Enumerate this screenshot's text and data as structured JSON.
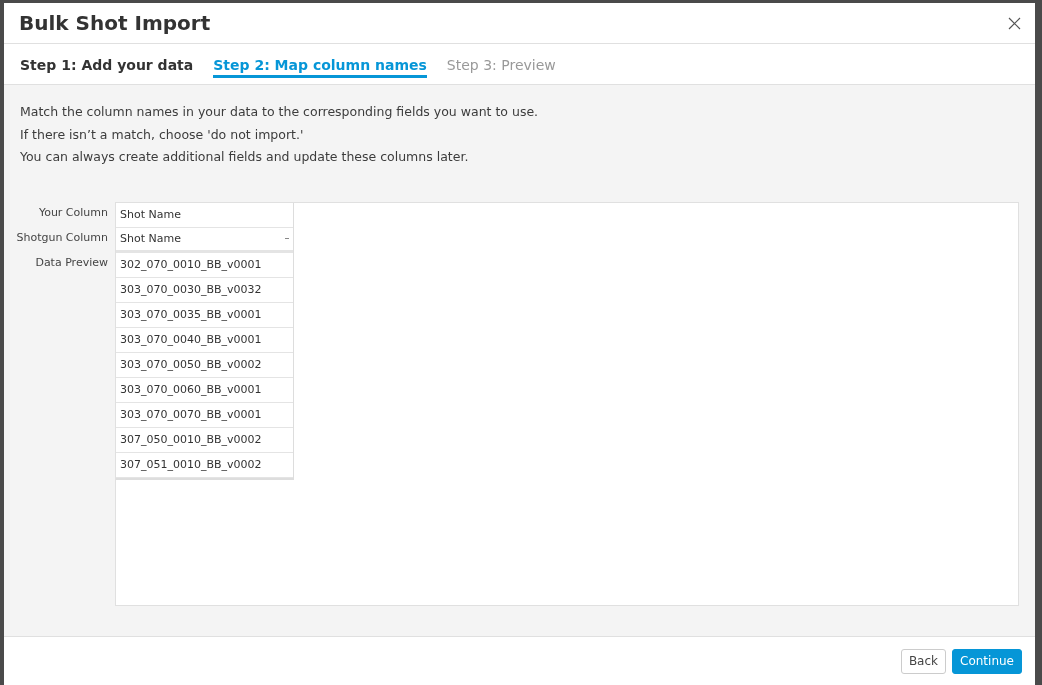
{
  "dialog": {
    "title": "Bulk Shot Import"
  },
  "steps": [
    {
      "label": "Step 1: Add your data",
      "selected": false,
      "disabled": false
    },
    {
      "label": "Step 2: Map column names",
      "selected": true,
      "disabled": false
    },
    {
      "label": "Step 3: Preview",
      "selected": false,
      "disabled": true
    }
  ],
  "instructions": [
    "Match the column names in your data to the corresponding fields you want to use.",
    "If there isn’t a match, choose 'do not import.'",
    "You can always create additional fields and update these columns later."
  ],
  "mapping": {
    "row_labels": [
      "Your Column",
      "Shotgun Column",
      "Data Preview"
    ],
    "your_column": "Shot Name",
    "shotgun_column": "Shot Name",
    "preview": [
      "302_070_0010_BB_v0001",
      "303_070_0030_BB_v0032",
      "303_070_0035_BB_v0001",
      "303_070_0040_BB_v0001",
      "303_070_0050_BB_v0002",
      "303_070_0060_BB_v0001",
      "303_070_0070_BB_v0001",
      "307_050_0010_BB_v0002",
      "307_051_0010_BB_v0002"
    ]
  },
  "buttons": [
    {
      "label": "Back",
      "kind": "secondary"
    },
    {
      "label": "Continue",
      "kind": "primary"
    }
  ]
}
